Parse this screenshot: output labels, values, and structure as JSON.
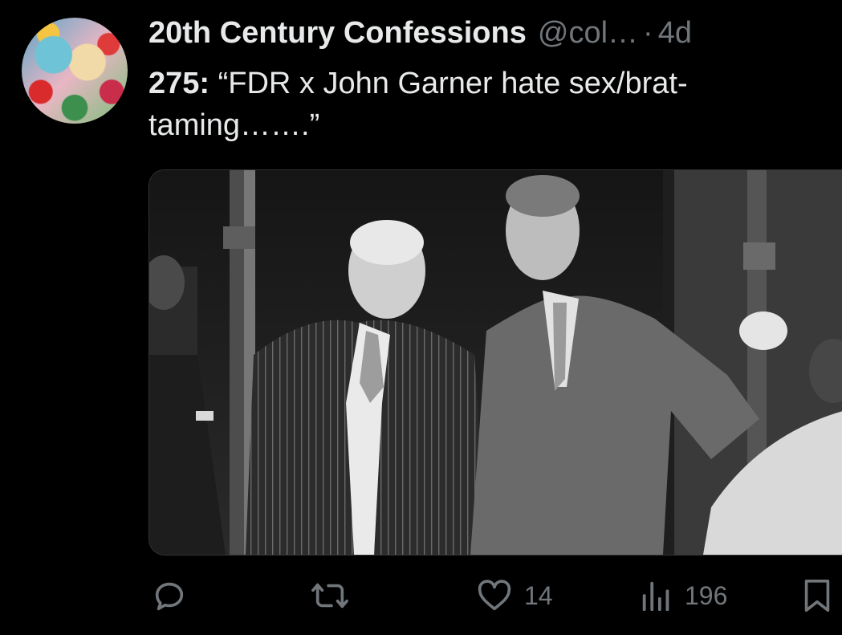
{
  "tweet": {
    "author_name": "20th Century Confessions",
    "handle": "@col…",
    "separator": "·",
    "time": "4d",
    "body_prefix": "275:",
    "body_text": " “FDR x John Garner hate sex/brat-taming…….”"
  },
  "actions": {
    "reply_count": "",
    "retweet_count": "",
    "like_count": "14",
    "views_count": "196"
  },
  "icons": {
    "reply": "reply-icon",
    "retweet": "retweet-icon",
    "like": "heart-icon",
    "views": "views-icon",
    "bookmark": "bookmark-icon"
  },
  "colors": {
    "background": "#000000",
    "text_primary": "#e7e9ea",
    "text_secondary": "#71767b"
  }
}
